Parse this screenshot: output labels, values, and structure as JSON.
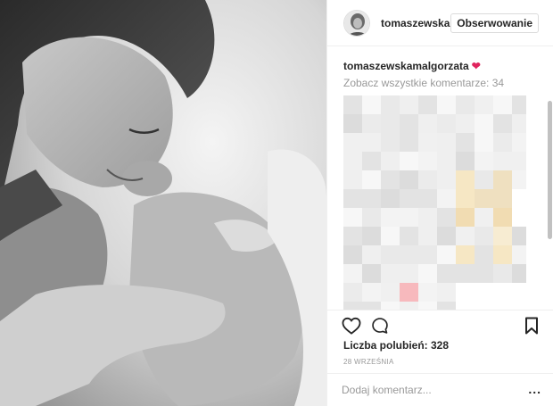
{
  "photo": {
    "alt": "",
    "style": "black-and-white"
  },
  "header": {
    "username": "tomaszewska",
    "follow_label": "Obserwowanie"
  },
  "post": {
    "caption_user": "tomaszewskamalgorzata",
    "caption_emoji": "❤️",
    "view_all_comments": "Zobacz wszystkie komentarze: 34"
  },
  "actions": {
    "like_icon": "heart-icon",
    "comment_icon": "comment-icon",
    "save_icon": "bookmark-icon"
  },
  "likes": "Liczba polubień: 328",
  "date": "28 WRZEŚNIA",
  "comment_box": {
    "placeholder": "Dodaj komentarz...",
    "more_label": "..."
  },
  "colors": {
    "border": "#efefef",
    "muted_text": "#999999",
    "text": "#262626",
    "heart": "#e0245e"
  }
}
